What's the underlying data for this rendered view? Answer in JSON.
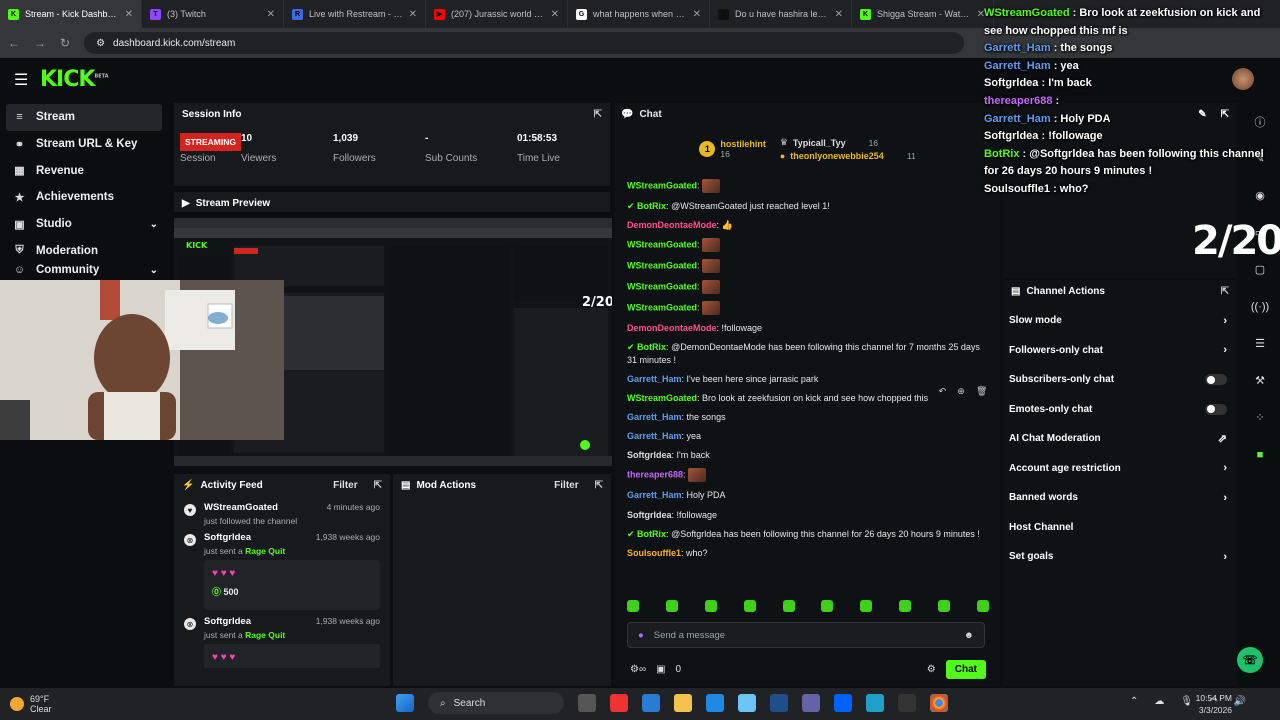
{
  "browser": {
    "tabs": [
      {
        "title": "Stream - Kick Dashboard",
        "color": "#53fc18",
        "letter": "K",
        "active": true
      },
      {
        "title": "(3) Twitch",
        "color": "#9146ff",
        "letter": "T"
      },
      {
        "title": "Live with Restream - Restr",
        "color": "#3b6ce6",
        "letter": "R"
      },
      {
        "title": "(207) Jurassic world Camp",
        "color": "#ff0000",
        "letter": "▶"
      },
      {
        "title": "what happens when you sl",
        "color": "#ffffff",
        "letter": "G"
      },
      {
        "title": "Do u have hashira level lu",
        "color": "#111111",
        "letter": "♪"
      },
      {
        "title": "Shigga Stream - Watch Liv",
        "color": "#53fc18",
        "letter": "K"
      }
    ],
    "url": "dashboard.kick.com/stream"
  },
  "header": {
    "logo": "KICK",
    "beta": "BETA"
  },
  "sidebar": {
    "items": [
      {
        "label": "Stream",
        "icon": "stream-icon",
        "glyph": "≡"
      },
      {
        "label": "Stream URL & Key",
        "icon": "link-icon",
        "glyph": "⚭"
      },
      {
        "label": "Revenue",
        "icon": "revenue-icon",
        "glyph": "▦"
      },
      {
        "label": "Achievements",
        "icon": "trophy-icon",
        "glyph": "★"
      },
      {
        "label": "Studio",
        "icon": "studio-icon",
        "glyph": "▣"
      },
      {
        "label": "Moderation",
        "icon": "shield-icon",
        "glyph": "⛨"
      },
      {
        "label": "Community",
        "icon": "community-icon",
        "glyph": "☺"
      }
    ]
  },
  "session": {
    "title": "Session Info",
    "badge": "STREAMING",
    "badge_label": "Session",
    "stats": [
      {
        "value": "10",
        "label": "Viewers"
      },
      {
        "value": "1,039",
        "label": "Followers"
      },
      {
        "value": "-",
        "label": "Sub Counts"
      },
      {
        "value": "01:58:53",
        "label": "Time Live"
      }
    ]
  },
  "preview": {
    "title": "Stream Preview"
  },
  "activity": {
    "title": "Activity Feed",
    "filter": "Filter",
    "items": [
      {
        "user": "WStreamGoated",
        "action": "just followed the channel",
        "time": "4 minutes ago"
      },
      {
        "user": "Softgrldea",
        "action": "just sent a",
        "highlight": "Rage Quit",
        "time": "1,938 weeks ago",
        "hearts": "♥ ♥ ♥",
        "amount": "500"
      },
      {
        "user": "Softgrldea",
        "action": "just sent a",
        "highlight": "Rage Quit",
        "time": "1,938 weeks ago",
        "hearts": "♥ ♥ ♥"
      }
    ]
  },
  "mod": {
    "title": "Mod Actions",
    "filter": "Filter"
  },
  "chat": {
    "title": "Chat",
    "leaderboard": {
      "top": {
        "name": "hostilehint",
        "count": "16",
        "rank": "1"
      },
      "right": [
        {
          "name": "Typicall_Tyy",
          "count": "16"
        },
        {
          "name": "theonlyonewebbie254",
          "count": "11"
        }
      ]
    },
    "messages": [
      {
        "user": "WStreamGoated",
        "color": "#53fc18",
        "text": "",
        "emote": true
      },
      {
        "user": "BotRix",
        "color": "#53fc18",
        "bot": true,
        "text": "@WStreamGoated just reached level 1!"
      },
      {
        "user": "DemonDeontaeMode",
        "color": "#ff4f8b",
        "text": "👍"
      },
      {
        "user": "WStreamGoated",
        "color": "#53fc18",
        "text": "",
        "emote": true
      },
      {
        "user": "WStreamGoated",
        "color": "#53fc18",
        "text": "",
        "emote": true
      },
      {
        "user": "WStreamGoated",
        "color": "#53fc18",
        "text": "",
        "emote": true
      },
      {
        "user": "WStreamGoated",
        "color": "#53fc18",
        "text": "",
        "emote": true
      },
      {
        "user": "DemonDeontaeMode",
        "color": "#ff4f8b",
        "text": "!followage"
      },
      {
        "user": "BotRix",
        "color": "#53fc18",
        "bot": true,
        "text": "@DemonDeontaeMode has been following this channel for 7 months 25 days 31 minutes !"
      },
      {
        "user": "Garrett_Ham",
        "color": "#5d9cf0",
        "text": "I've been here since jarrasic park"
      },
      {
        "user": "WStreamGoated",
        "color": "#53fc18",
        "text": "Bro look at zeekfusion on kick and see how chopped this"
      },
      {
        "user": "Garrett_Ham",
        "color": "#5d9cf0",
        "text": "the songs"
      },
      {
        "user": "Garrett_Ham",
        "color": "#5d9cf0",
        "text": "yea"
      },
      {
        "user": "Softgrldea",
        "color": "#ddd",
        "text": "I'm back"
      },
      {
        "user": "thereaper688",
        "color": "#c866ff",
        "text": "",
        "emote": true
      },
      {
        "user": "Garrett_Ham",
        "color": "#5d9cf0",
        "text": "Holy PDA"
      },
      {
        "user": "Softgrldea",
        "color": "#ddd",
        "text": "!followage"
      },
      {
        "user": "BotRix",
        "color": "#53fc18",
        "bot": true,
        "text": "@Softgrldea has been following this channel for 26 days 20 hours 9 minutes !"
      },
      {
        "user": "Soulsouffle1",
        "color": "#ffb020",
        "text": "who?"
      }
    ],
    "placeholder": "Send a message",
    "points": "0",
    "send_label": "Chat"
  },
  "channel_actions": {
    "title": "Channel Actions",
    "items": [
      {
        "label": "Slow mode",
        "kind": "arrow"
      },
      {
        "label": "Followers-only chat",
        "kind": "arrow"
      },
      {
        "label": "Subscribers-only chat",
        "kind": "toggle"
      },
      {
        "label": "Emotes-only chat",
        "kind": "toggle"
      },
      {
        "label": "AI Chat Moderation",
        "kind": "external"
      },
      {
        "label": "Account age restriction",
        "kind": "arrow"
      },
      {
        "label": "Banned words",
        "kind": "arrow"
      },
      {
        "label": "Host Channel",
        "kind": "none"
      },
      {
        "label": "Set goals",
        "kind": "arrow"
      }
    ]
  },
  "overlay": {
    "lines": [
      {
        "user": "WStreamGoated",
        "text": "Bro look at zeekfusion on kick and see how chopped this mf is"
      },
      {
        "user": "Garrett_Ham",
        "text": "the songs"
      },
      {
        "user": "Garrett_Ham",
        "text": "yea"
      },
      {
        "user": "Softgrldea",
        "text": "I'm back"
      },
      {
        "user": "thereaper688",
        "text": ""
      },
      {
        "user": "Garrett_Ham",
        "text": "Holy PDA"
      },
      {
        "user": "Softgrldea",
        "text": "!followage"
      },
      {
        "user": "BotRix",
        "text": "@Softgrldea has been following this channel for 26 days 20 hours 9 minutes !"
      },
      {
        "user": "Soulsouffle1",
        "text": "who?"
      }
    ],
    "counter": "2/20"
  },
  "taskbar": {
    "temp": "69°F",
    "condition": "Clear",
    "search": "Search",
    "time": "10:54 PM",
    "date": "3/3/2026"
  }
}
